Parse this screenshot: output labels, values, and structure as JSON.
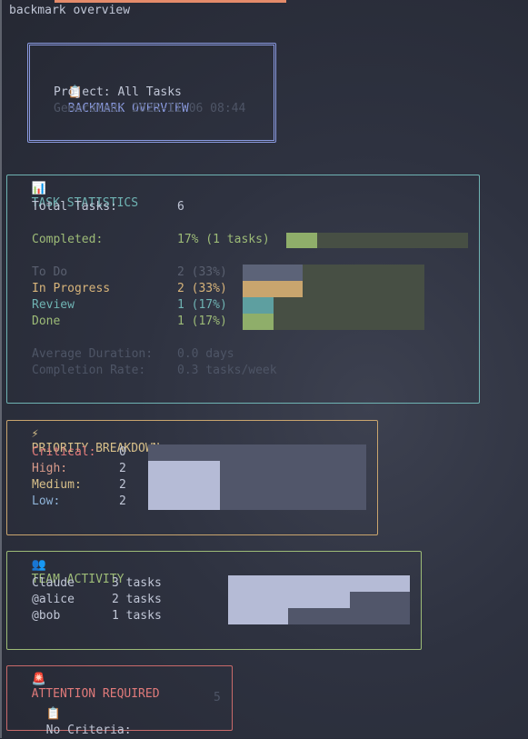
{
  "window": {
    "title": "backmark overview"
  },
  "header": {
    "icon": "📋",
    "title": "BACKMARK OVERVIEW",
    "project": "Project: All Tasks",
    "generated": "Generated: 2025-11-06 08:44"
  },
  "stats": {
    "icon": "📊",
    "title": "TASK STATISTICS",
    "total_label": "Total Tasks:",
    "total_value": "6",
    "completed_label": "Completed:",
    "completed_value": "17% (1 tasks)",
    "completed_fraction": 0.17,
    "statuses": [
      {
        "label": "To Do",
        "value": "2 (33%)",
        "fraction": 0.33,
        "color": "#5c6378",
        "text_color": "#5a6070"
      },
      {
        "label": "In Progress",
        "value": "2 (33%)",
        "fraction": 0.33,
        "color": "#c9a56e",
        "text_color": "#d8b47a"
      },
      {
        "label": "Review",
        "value": "1 (17%)",
        "fraction": 0.17,
        "color": "#5e9fa0",
        "text_color": "#6fb3b3"
      },
      {
        "label": "Done",
        "value": "1 (17%)",
        "fraction": 0.17,
        "color": "#8fae6a",
        "text_color": "#9dbb77"
      }
    ],
    "avg_label": "Average Duration:",
    "avg_value": "0.0 days",
    "rate_label": "Completion Rate:",
    "rate_value": "0.3 tasks/week"
  },
  "priority": {
    "icon": "⚡",
    "title": "PRIORITY BREAKDOWN",
    "rows": [
      {
        "label": "Critical:",
        "value": "0",
        "fraction": 0.0,
        "text_color": "#e07a7a"
      },
      {
        "label": "High:",
        "value": "2",
        "fraction": 0.33,
        "text_color": "#d89a8a"
      },
      {
        "label": "Medium:",
        "value": "2",
        "fraction": 0.33,
        "text_color": "#d8c08a"
      },
      {
        "label": "Low:",
        "value": "2",
        "fraction": 0.33,
        "text_color": "#8fb3d8"
      }
    ]
  },
  "team": {
    "icon": "👥",
    "title": "TEAM ACTIVITY",
    "members": [
      {
        "name": "Claude",
        "tasks": "3 tasks",
        "fraction": 1.0
      },
      {
        "name": "@alice",
        "tasks": "2 tasks",
        "fraction": 0.67
      },
      {
        "name": "@bob",
        "tasks": "1 tasks",
        "fraction": 0.33
      }
    ]
  },
  "attention": {
    "icon": "🚨",
    "title": "ATTENTION REQUIRED",
    "item_icon": "📋",
    "item_label": "No Criteria:",
    "item_value": "5"
  },
  "colors": {
    "accent": "#8a9ae0",
    "stats_border": "#6fb3b3",
    "priority_border": "#c9a56e",
    "team_border": "#9dbb77",
    "attention_border": "#c96a6a",
    "bar_track": "#474f44",
    "priority_fill": "#b5bbd6",
    "priority_track": "#51566a"
  }
}
